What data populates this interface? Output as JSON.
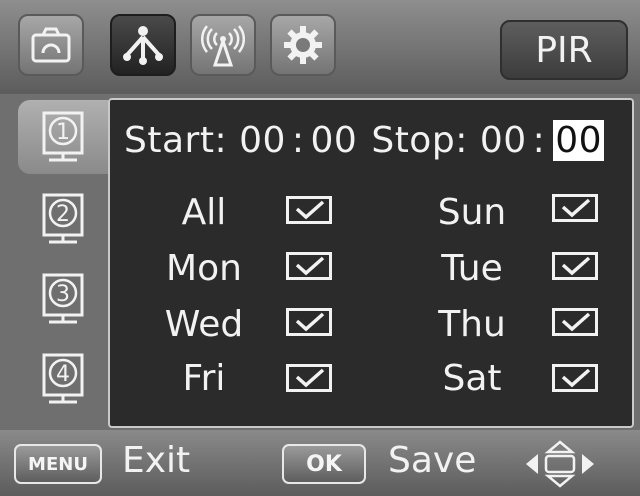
{
  "header": {
    "tabs": [
      {
        "icon": "camera-icon",
        "active": false
      },
      {
        "icon": "pir-sensor-icon",
        "active": true
      },
      {
        "icon": "wireless-signal-icon",
        "active": false
      },
      {
        "icon": "gear-icon",
        "active": false
      }
    ],
    "mode_label": "PIR"
  },
  "sidebar": {
    "slots": [
      {
        "label": "1",
        "active": true
      },
      {
        "label": "2",
        "active": false
      },
      {
        "label": "3",
        "active": false
      },
      {
        "label": "4",
        "active": false
      }
    ]
  },
  "schedule": {
    "start_label": "Start:",
    "start_hour": "00",
    "start_minute": "00",
    "stop_label": "Stop:",
    "stop_hour": "00",
    "stop_minute": "00",
    "time_separator": ":",
    "days": [
      {
        "label": "All",
        "checked": true
      },
      {
        "label": "Sun",
        "checked": true
      },
      {
        "label": "Mon",
        "checked": true
      },
      {
        "label": "Tue",
        "checked": true
      },
      {
        "label": "Wed",
        "checked": true
      },
      {
        "label": "Thu",
        "checked": true
      },
      {
        "label": "Fri",
        "checked": true
      },
      {
        "label": "Sat",
        "checked": true
      }
    ]
  },
  "footer": {
    "menu_key": "MENU",
    "exit_label": "Exit",
    "ok_key": "OK",
    "save_label": "Save"
  }
}
